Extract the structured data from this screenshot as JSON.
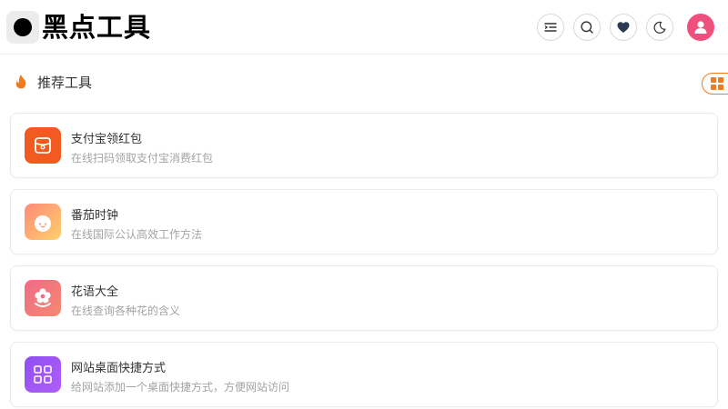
{
  "header": {
    "logo_text": "黑点工具",
    "buttons": [
      {
        "icon": "menu-indent-icon"
      },
      {
        "icon": "search-icon"
      },
      {
        "icon": "heart-icon"
      },
      {
        "icon": "moon-icon"
      }
    ],
    "avatar_icon": "user-icon"
  },
  "section": {
    "icon": "fire-icon",
    "title": "推荐工具",
    "toggle_icon": "grid-icon"
  },
  "tools": [
    {
      "title": "支付宝领红包",
      "desc": "在线扫码领取支付宝消费红包",
      "icon": "red-packet-icon",
      "color": "#f25a1f"
    },
    {
      "title": "番茄时钟",
      "desc": "在线国际公认高效工作方法",
      "icon": "tomato-icon",
      "color": "#fdb95c"
    },
    {
      "title": "花语大全",
      "desc": "在线查询各种花的含义",
      "icon": "flower-icon",
      "color": "#f2617d"
    },
    {
      "title": "网站桌面快捷方式",
      "desc": "给网站添加一个桌面快捷方式，方便网站访问",
      "icon": "shortcut-icon",
      "color": "#9b56f5"
    }
  ],
  "colors": {
    "accent": "#f07a1e",
    "avatar": "#f0507e",
    "heart": "#2b3a55"
  }
}
